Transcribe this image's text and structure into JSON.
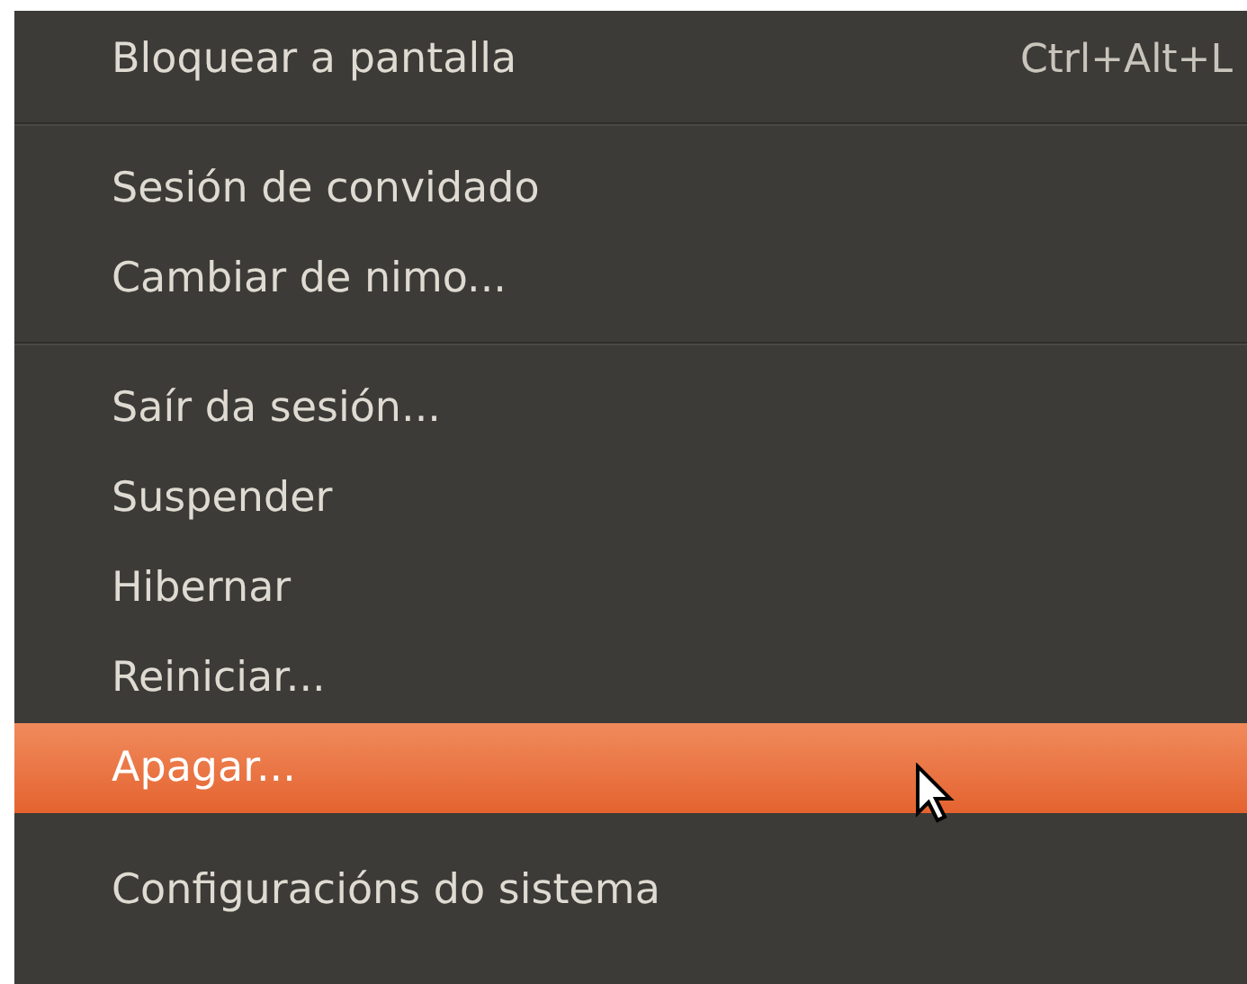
{
  "menu": {
    "items": [
      {
        "kind": "item",
        "label": "Bloquear a pantalla",
        "shortcut": "Ctrl+Alt+L",
        "selected": false
      },
      {
        "kind": "separator"
      },
      {
        "kind": "item",
        "label": "Sesión de convidado",
        "selected": false
      },
      {
        "kind": "item",
        "label": "Cambiar de nimo...",
        "selected": false
      },
      {
        "kind": "separator"
      },
      {
        "kind": "item",
        "label": "Saír da sesión...",
        "selected": false
      },
      {
        "kind": "item",
        "label": "Suspender",
        "selected": false
      },
      {
        "kind": "item",
        "label": "Hibernar",
        "selected": false
      },
      {
        "kind": "item",
        "label": "Reiniciar...",
        "selected": false
      },
      {
        "kind": "item",
        "label": "Apagar...",
        "selected": true
      },
      {
        "kind": "gap"
      },
      {
        "kind": "item",
        "label": "Configuracións do sistema",
        "selected": false
      }
    ]
  }
}
